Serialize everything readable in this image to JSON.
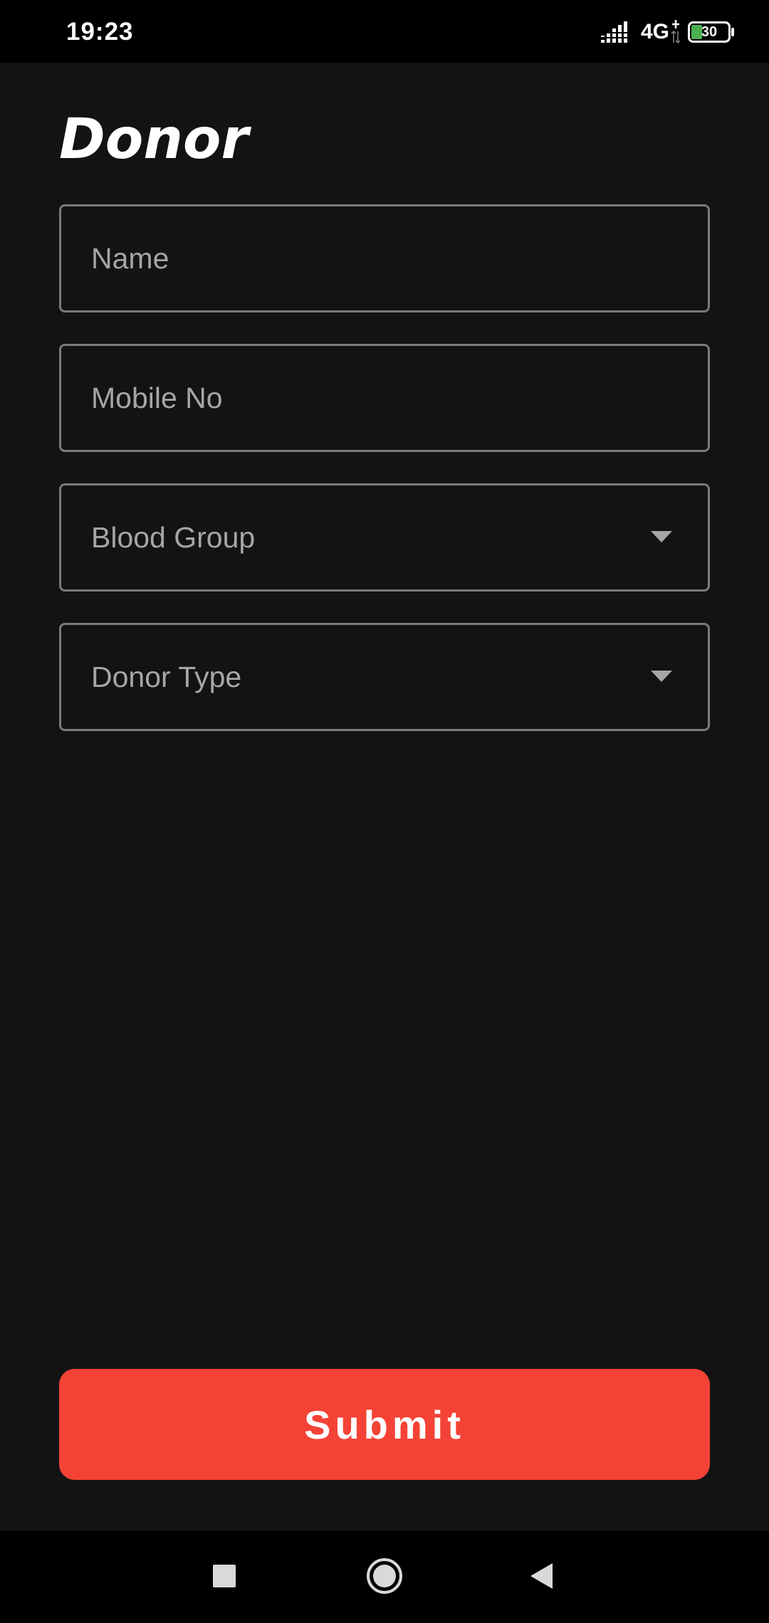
{
  "status_bar": {
    "time": "19:23",
    "network": "4G",
    "battery": "30",
    "icons": [
      "signal-icon",
      "data-arrows-icon",
      "battery-icon"
    ],
    "battery_fill_color": "#4caf50"
  },
  "page": {
    "title": "Donor"
  },
  "form": {
    "name_placeholder": "Name",
    "mobile_placeholder": "Mobile No",
    "blood_group_label": "Blood Group",
    "donor_type_label": "Donor Type",
    "dropdown_icon": "dropdown-arrow-icon"
  },
  "submit": {
    "label": "Submit",
    "color": "#f44336"
  },
  "nav_bar": {
    "icons": [
      "recents-square-icon",
      "home-circle-icon",
      "back-triangle-icon"
    ]
  },
  "colors": {
    "background": "#131313",
    "bars": "#000000",
    "field_border": "#7a7a7a",
    "placeholder": "#a6a6a6"
  }
}
